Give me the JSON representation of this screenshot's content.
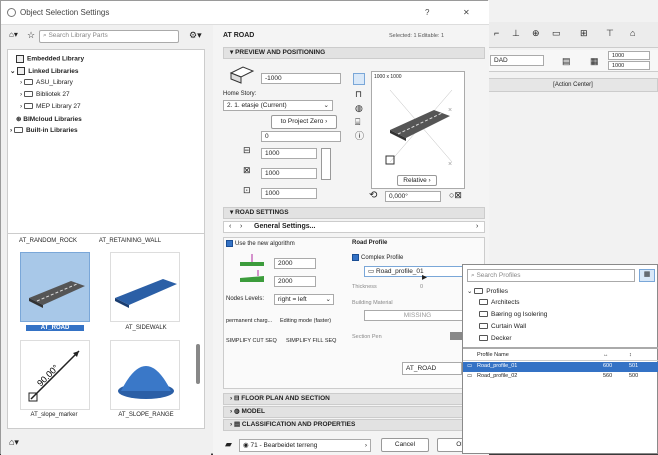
{
  "dialog": {
    "title": "Object Selection Settings",
    "help": "?",
    "close": "✕",
    "cursor_glyph": "▸"
  },
  "left": {
    "search_placeholder": "Search Library Parts",
    "tree": [
      {
        "label": "Embedded Library",
        "level": 0
      },
      {
        "label": "Linked Libraries",
        "level": 0
      },
      {
        "label": "ASU_Library",
        "level": 1
      },
      {
        "label": "Bibliotek 27",
        "level": 1
      },
      {
        "label": "MEP Library 27",
        "level": 1
      },
      {
        "label": "BIMcloud Libraries",
        "level": 0
      },
      {
        "label": "Built-in Libraries",
        "level": 0
      }
    ],
    "header_labels": [
      "AT_RANDOM_ROCK",
      "AT_RETAINING_WALL"
    ],
    "thumbs": [
      {
        "label": "AT_ROAD",
        "selected": true
      },
      {
        "label": "AT_SIDEWALK",
        "selected": false
      },
      {
        "label": "AT_slope_marker",
        "selected": false
      },
      {
        "label": "AT_SLOPE_RANGE",
        "selected": false
      }
    ],
    "slope_text": "90.00°"
  },
  "right": {
    "object_name": "AT ROAD",
    "selected_info": "Selected: 1 Editable: 1",
    "sections": {
      "preview": "PREVIEW AND POSITIONING",
      "road_settings": "ROAD SETTINGS",
      "floor_plan": "FLOOR PLAN AND SECTION",
      "model": "MODEL",
      "classification": "CLASSIFICATION AND PROPERTIES"
    },
    "preview": {
      "elevation": "-1000",
      "home_story_label": "Home Story:",
      "home_story_value": "2. 1. etasje (Current)",
      "to_project_zero": "to Project Zero",
      "project_zero_value": "0",
      "dim_a": "1000",
      "dim_b": "1000",
      "dim_c": "1000",
      "plan_dims": "1000 x 1000",
      "relative": "Relative",
      "angle": "0,000°"
    },
    "road": {
      "general_settings": "General Settings...",
      "use_new_algorithm": "Use the new algorithm",
      "width_1": "2000",
      "width_2": "2000",
      "nodes_levels_label": "Nodes Levels:",
      "nodes_levels_value": "right = left",
      "permanent_change": "permanent charg...",
      "editing_mode": "Editing mode (faster)",
      "simplify_cut": "SIMPLIFY CUT SEQ",
      "simplify_fill": "SIMPLIFY FILL SEQ",
      "road_profile_heading": "Road Profile",
      "complex_profile": "Complex Profile",
      "profile_selected": "Road_profile_01",
      "thickness_label": "Thickness",
      "thickness_value": "0",
      "building_material_label": "Building Material",
      "building_material_value": "MISSING",
      "section_pen_label": "Section Pen",
      "id_value": "AT_ROAD"
    },
    "footer": {
      "layer": "71 - Bearbeidet terreng",
      "cancel": "Cancel",
      "ok": "OK"
    }
  },
  "background": {
    "field_value": "DAD",
    "num_top": "1000",
    "num_bottom": "1000",
    "action_center": "[Action Center]"
  },
  "profile_popup": {
    "search_placeholder": "Search Profiles",
    "tree": [
      {
        "label": "Profiles",
        "level": 0
      },
      {
        "label": "Architects",
        "level": 1
      },
      {
        "label": "Bæring og Isolering",
        "level": 1
      },
      {
        "label": "Curtain Wall",
        "level": 1
      },
      {
        "label": "Decker",
        "level": 1
      }
    ],
    "table_headers": [
      "Profile Name",
      "↔",
      "↕"
    ],
    "rows": [
      {
        "name": "Road_profile_01",
        "w": "600",
        "h": "501",
        "selected": true
      },
      {
        "name": "Road_profile_02",
        "w": "560",
        "h": "500",
        "selected": false
      }
    ]
  },
  "colors": {
    "accent": "#3472c5",
    "selection_bg": "#a8c8e8"
  }
}
